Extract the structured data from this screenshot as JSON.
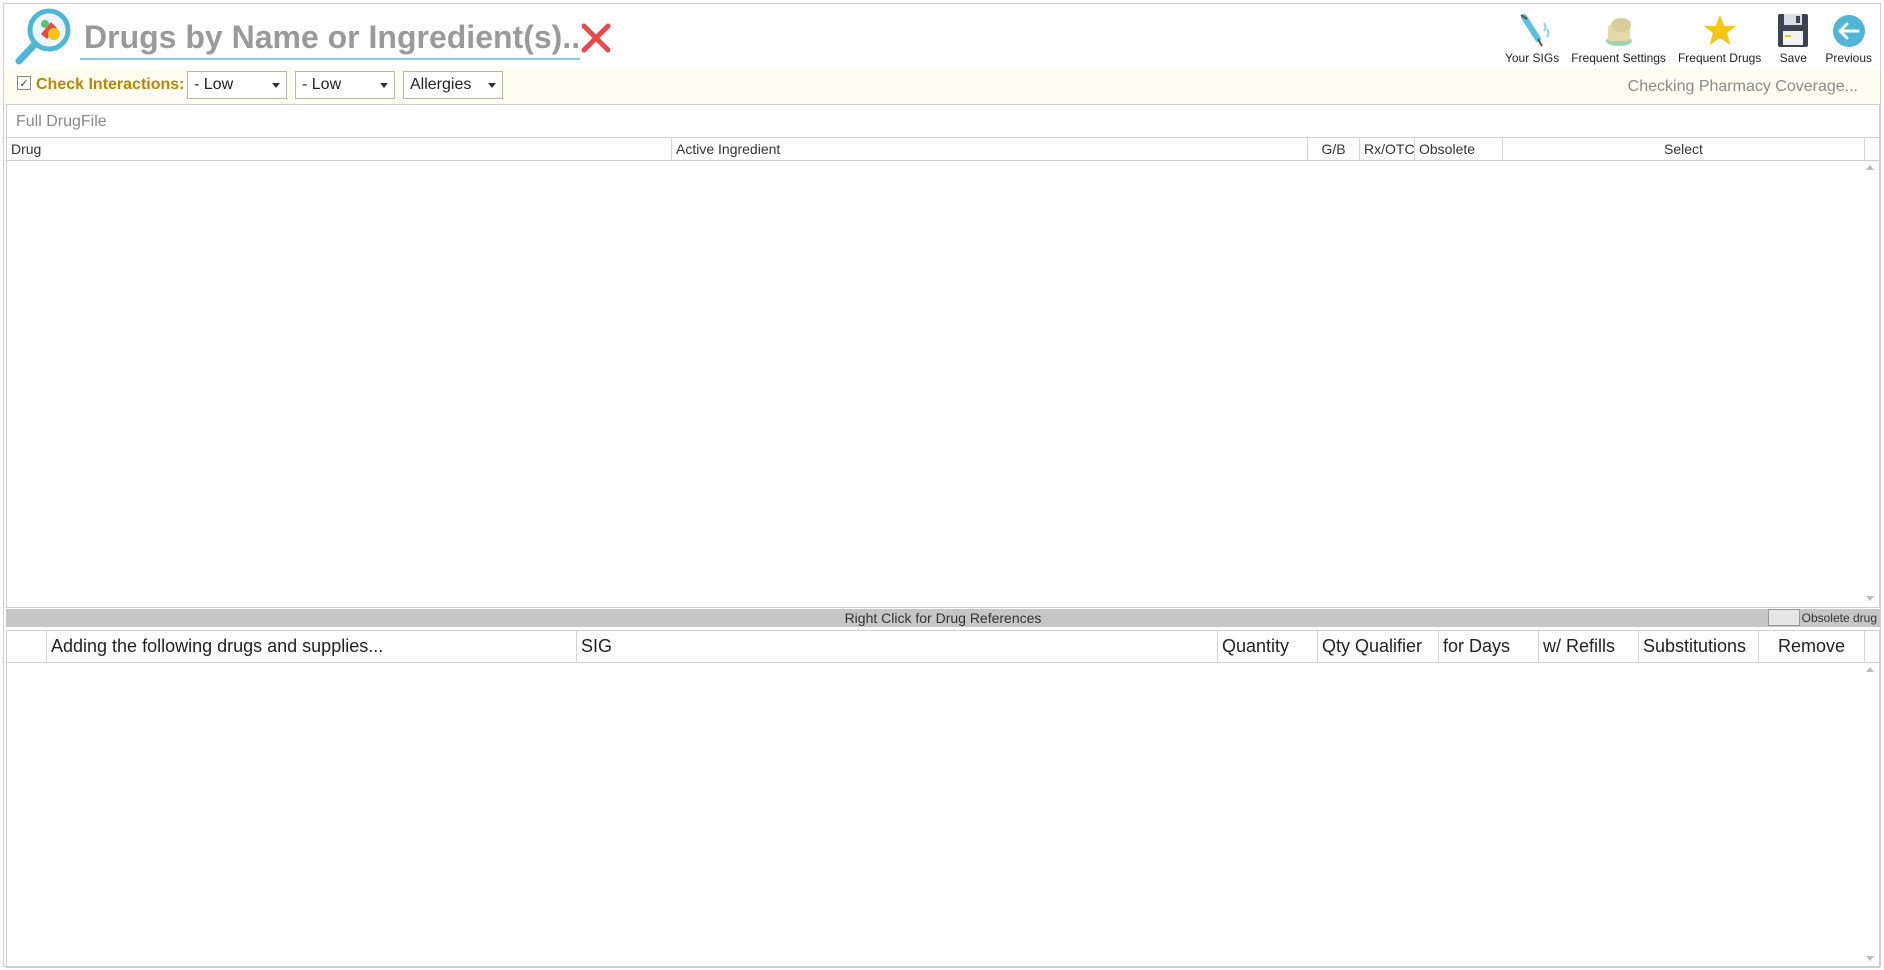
{
  "search": {
    "placeholder": "Drugs by Name or Ingredient(s)..."
  },
  "toolbar": [
    {
      "label": "Your SIGs",
      "icon": "syringe-icon"
    },
    {
      "label": "Frequent Settings",
      "icon": "pill-bottle-icon"
    },
    {
      "label": "Frequent Drugs",
      "icon": "star-icon"
    },
    {
      "label": "Save",
      "icon": "floppy-disk-icon"
    },
    {
      "label": "Previous",
      "icon": "back-arrow-icon"
    }
  ],
  "interactions": {
    "checked": true,
    "label": "Check Interactions:",
    "severity1": "- Low",
    "severity2": "- Low",
    "allergies": "Allergies",
    "status": "Checking Pharmacy Coverage..."
  },
  "drug_grid": {
    "caption": "Full DrugFile",
    "columns": [
      "Drug",
      "Active Ingredient",
      "G/B",
      "Rx/OTC",
      "Obsolete",
      "Select"
    ]
  },
  "reference_bar": {
    "text": "Right Click for Drug References",
    "legend": "Obsolete drug"
  },
  "order_grid": {
    "columns": [
      "",
      "Adding the following drugs and supplies...",
      "SIG",
      "Quantity",
      "Qty Qualifier",
      "for Days",
      "w/ Refills",
      "Substitutions",
      "Remove"
    ]
  },
  "colors": {
    "accent": "#7fd0ea",
    "label": "#b8860b",
    "clear": "#e84a4a",
    "star": "#f5c518",
    "back": "#4fb6d8"
  }
}
